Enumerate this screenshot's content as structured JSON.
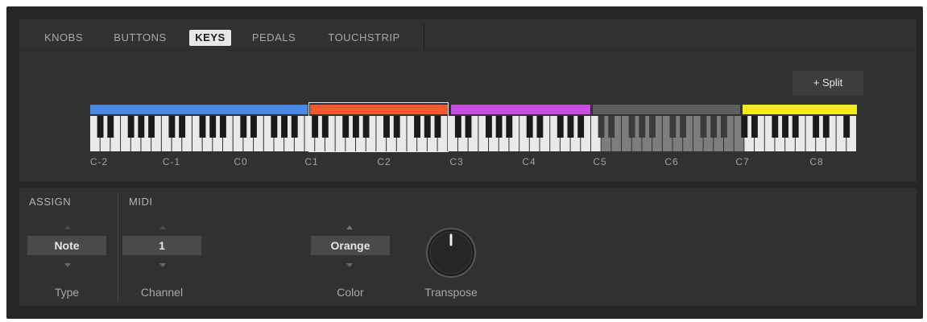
{
  "tabs": [
    {
      "label": "KNOBS",
      "active": false
    },
    {
      "label": "BUTTONS",
      "active": false
    },
    {
      "label": "KEYS",
      "active": true
    },
    {
      "label": "PEDALS",
      "active": false
    },
    {
      "label": "TOUCHSTRIP",
      "active": false
    }
  ],
  "split_button": "+ Split",
  "zone_colors": {
    "blue": "#4b87e6",
    "orange": "#f2582c",
    "purple": "#c64be0",
    "gray": "#5f5f5f",
    "yellow": "#f2ea1d"
  },
  "octave_labels": [
    "C-2",
    "C-1",
    "C0",
    "C1",
    "C2",
    "C3",
    "C4",
    "C5",
    "C6",
    "C7",
    "C8"
  ],
  "assign": {
    "title": "ASSIGN",
    "type_value": "Note",
    "type_label": "Type"
  },
  "midi": {
    "title": "MIDI",
    "channel_value": "1",
    "channel_label": "Channel",
    "color_value": "Orange",
    "color_label": "Color",
    "transpose_label": "Transpose"
  }
}
